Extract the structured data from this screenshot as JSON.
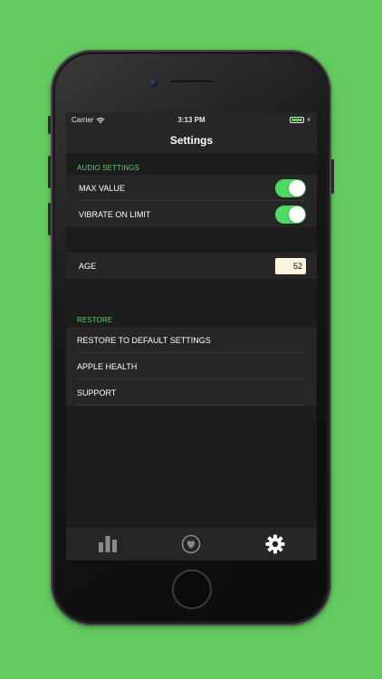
{
  "status_bar": {
    "carrier": "Carrier",
    "time": "3:13 PM",
    "wifi_icon": "wifi-icon",
    "battery_icon": "battery-icon"
  },
  "nav": {
    "title": "Settings"
  },
  "audio_section": {
    "header": "AUDIO SETTINGS",
    "items": [
      {
        "label": "MAX VALUE",
        "toggle_on": true
      },
      {
        "label": "VIBRATE ON LIMIT",
        "toggle_on": true
      }
    ]
  },
  "age": {
    "label": "AGE",
    "value": "52"
  },
  "restore_section": {
    "header": "RESTORE",
    "items": [
      {
        "label": "RESTORE TO DEFAULT SETTINGS"
      },
      {
        "label": "APPLE HEALTH"
      },
      {
        "label": "SUPPORT"
      }
    ]
  },
  "tab_bar": {
    "tabs": [
      {
        "icon": "bar-chart-icon",
        "selected": false
      },
      {
        "icon": "heart-icon",
        "selected": false
      },
      {
        "icon": "gear-icon",
        "selected": true
      }
    ]
  },
  "colors": {
    "background": "#64c95f",
    "accent": "#4cd964",
    "screen": "#1c1c1c",
    "row": "#262626",
    "age_field": "#fbf5dc"
  }
}
